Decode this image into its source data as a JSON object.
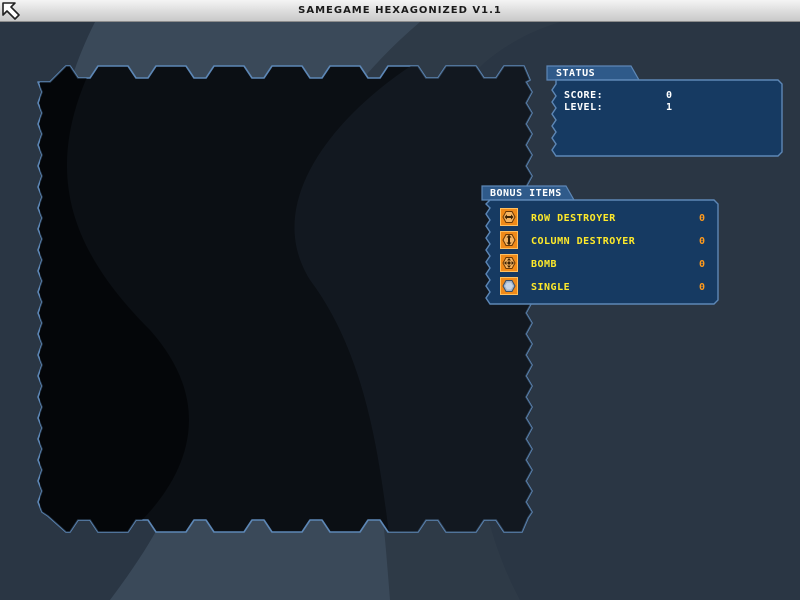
{
  "window": {
    "title": "SAMEGAME HEXAGONIZED V1.1",
    "icon": "arrow-cursor-icon"
  },
  "status_panel": {
    "tab_label": "STATUS",
    "rows": [
      {
        "label": "SCORE:",
        "value": "0"
      },
      {
        "label": "LEVEL:",
        "value": "1"
      }
    ]
  },
  "bonus_panel": {
    "tab_label": "BONUS ITEMS",
    "items": [
      {
        "icon": "row-destroyer-icon",
        "label": "ROW DESTROYER",
        "count": "0"
      },
      {
        "icon": "column-destroyer-icon",
        "label": "COLUMN DESTROYER",
        "count": "0"
      },
      {
        "icon": "bomb-icon",
        "label": "BOMB",
        "count": "0"
      },
      {
        "icon": "single-icon",
        "label": "SINGLE",
        "count": "0"
      }
    ]
  },
  "colors": {
    "background": "#2a3644",
    "panel_fill": "#163a62",
    "panel_border": "#5d87b6",
    "board_fill": "#0b0f14",
    "label_yellow": "#ffea2a",
    "count_orange": "#ff9a1c",
    "button_orange": "#f08a18"
  }
}
